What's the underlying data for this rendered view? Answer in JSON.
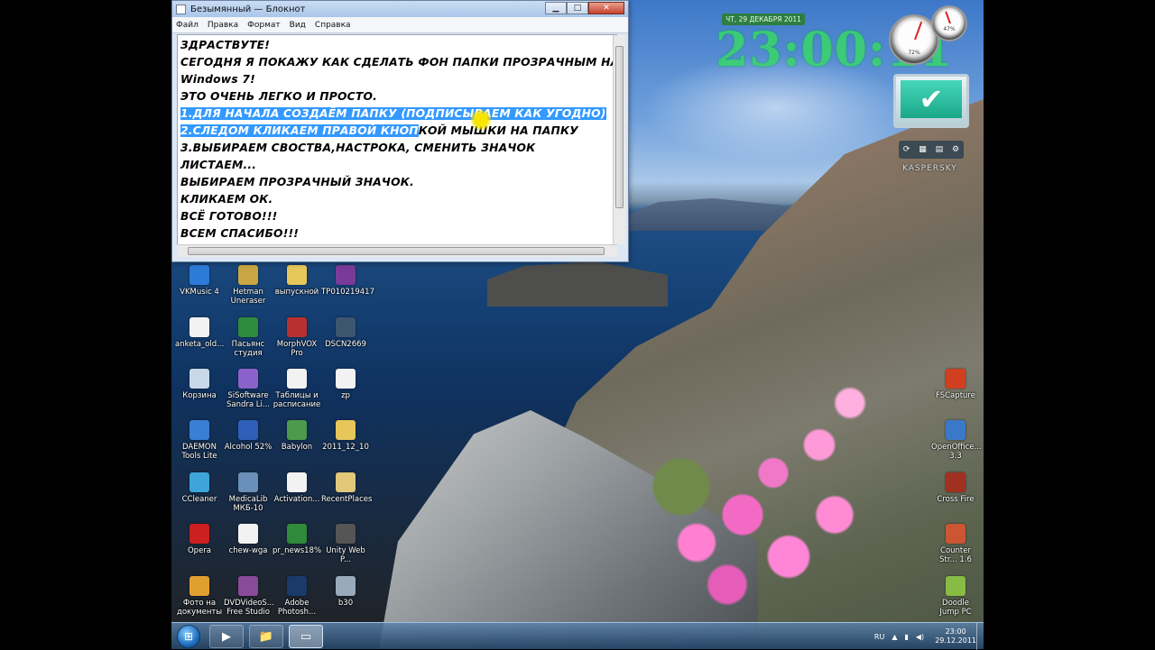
{
  "notepad": {
    "title": "Безымянный — Блокнот",
    "controls": {
      "minimize": "▁",
      "maximize": "□",
      "close": "✕"
    },
    "menu": [
      "Файл",
      "Правка",
      "Формат",
      "Вид",
      "Справка"
    ],
    "lines": [
      "ЗДРАСТВУТЕ!",
      "СЕГОДНЯ Я ПОКАЖУ КАК СДЕЛАТЬ ФОН ПАПКИ ПРОЗРАЧНЫМ НА",
      "Windows 7!",
      "ЭТО ОЧЕНЬ ЛЕГКО И ПРОСТО.",
      "1.ДЛЯ НАЧАЛА СОЗДАЁМ ПАПКУ (ПОДПИСЫВАЕМ КАК УГОДНО)",
      "3.ВЫБИРАЕМ СВОСТВА,НАСТРОКА, СМЕНИТЬ ЗНАЧОК",
      "ЛИСТАЕМ...",
      "ВЫБИРАЕМ ПРОЗРАЧНЫЙ ЗНАЧОК.",
      "КЛИКАЕМ ОК.",
      "ВСЁ ГОТОВО!!!",
      "ВСЕМ СПАСИБО!!!"
    ],
    "line2_selected": "2.СЛЕДОМ КЛИКАЕМ ПРАВОЙ КНОП",
    "line2_rest": "КОЙ МЫШКИ НА ПАПКУ"
  },
  "desktop": {
    "icons": [
      {
        "label": "VKMusic 4",
        "color": "#2d7bd8"
      },
      {
        "label": "Hetman Uneraser",
        "color": "#c9a544"
      },
      {
        "label": "выпускной",
        "color": "#e7c65a"
      },
      {
        "label": "TP010219417",
        "color": "#7a3a9a"
      },
      {
        "label": "anketa_old...",
        "color": "#f2f2f2"
      },
      {
        "label": "Пасьянс студия",
        "color": "#2e8a3e"
      },
      {
        "label": "MorphVOX Pro",
        "color": "#b83030"
      },
      {
        "label": "DSCN2669",
        "color": "#3d5670"
      },
      {
        "label": "Корзина",
        "color": "#c8d8e8"
      },
      {
        "label": "SiSoftware Sandra Li...",
        "color": "#8a62c9"
      },
      {
        "label": "Таблицы и расписание",
        "color": "#f2f2f2"
      },
      {
        "label": "zp",
        "color": "#f2f2f2"
      },
      {
        "label": "DAEMON Tools Lite",
        "color": "#3a7fd6"
      },
      {
        "label": "Alcohol 52%",
        "color": "#2f5fb8"
      },
      {
        "label": "Babylon",
        "color": "#4c9a4c"
      },
      {
        "label": "2011_12_10",
        "color": "#e7c65a"
      },
      {
        "label": "CCleaner",
        "color": "#3da5d9"
      },
      {
        "label": "MedicaLib МКБ-10",
        "color": "#6a8fb8"
      },
      {
        "label": "Activation...",
        "color": "#f2f2f2"
      },
      {
        "label": "RecentPlaces",
        "color": "#e0c77a"
      },
      {
        "label": "Opera",
        "color": "#cc1f1f"
      },
      {
        "label": "chew-wga",
        "color": "#f2f2f2"
      },
      {
        "label": "pr_news18%",
        "color": "#2f8a3a"
      },
      {
        "label": "Unity Web P...",
        "color": "#555"
      },
      {
        "label": "Фото на документы",
        "color": "#e0a030"
      },
      {
        "label": "DVDVideoS... Free Studio",
        "color": "#8a4a9a"
      },
      {
        "label": "Adobe Photosh...",
        "color": "#1a3a6a"
      },
      {
        "label": "b30",
        "color": "#9ab"
      },
      {
        "label": "FSCapture",
        "color": "#d04020"
      },
      {
        "label": "OpenOffice... 3.3",
        "color": "#3a78c8"
      },
      {
        "label": "Cross Fire",
        "color": "#a03020"
      },
      {
        "label": "Counter Str... 1.6",
        "color": "#cc5533"
      },
      {
        "label": "Doodle Jump PC",
        "color": "#88bb44"
      }
    ]
  },
  "clock_gadget": {
    "date": "ЧТ, 29 ДЕКАБРЯ 2011",
    "time": "23:00:11"
  },
  "meter_gadget": {
    "cpu": "72%",
    "mem": "47%"
  },
  "kaspersky": {
    "check": "✔",
    "toolbar": [
      "⟳",
      "▦",
      "▤",
      "⚙"
    ],
    "logo": "KASPERSKY"
  },
  "taskbar": {
    "start": "⊞",
    "pinned": [
      "▶",
      "📁",
      "▭"
    ],
    "language": "RU",
    "tray_icons": [
      "▲",
      "▮",
      "◀)"
    ],
    "time": "23:00",
    "date": "29.12.2011"
  }
}
